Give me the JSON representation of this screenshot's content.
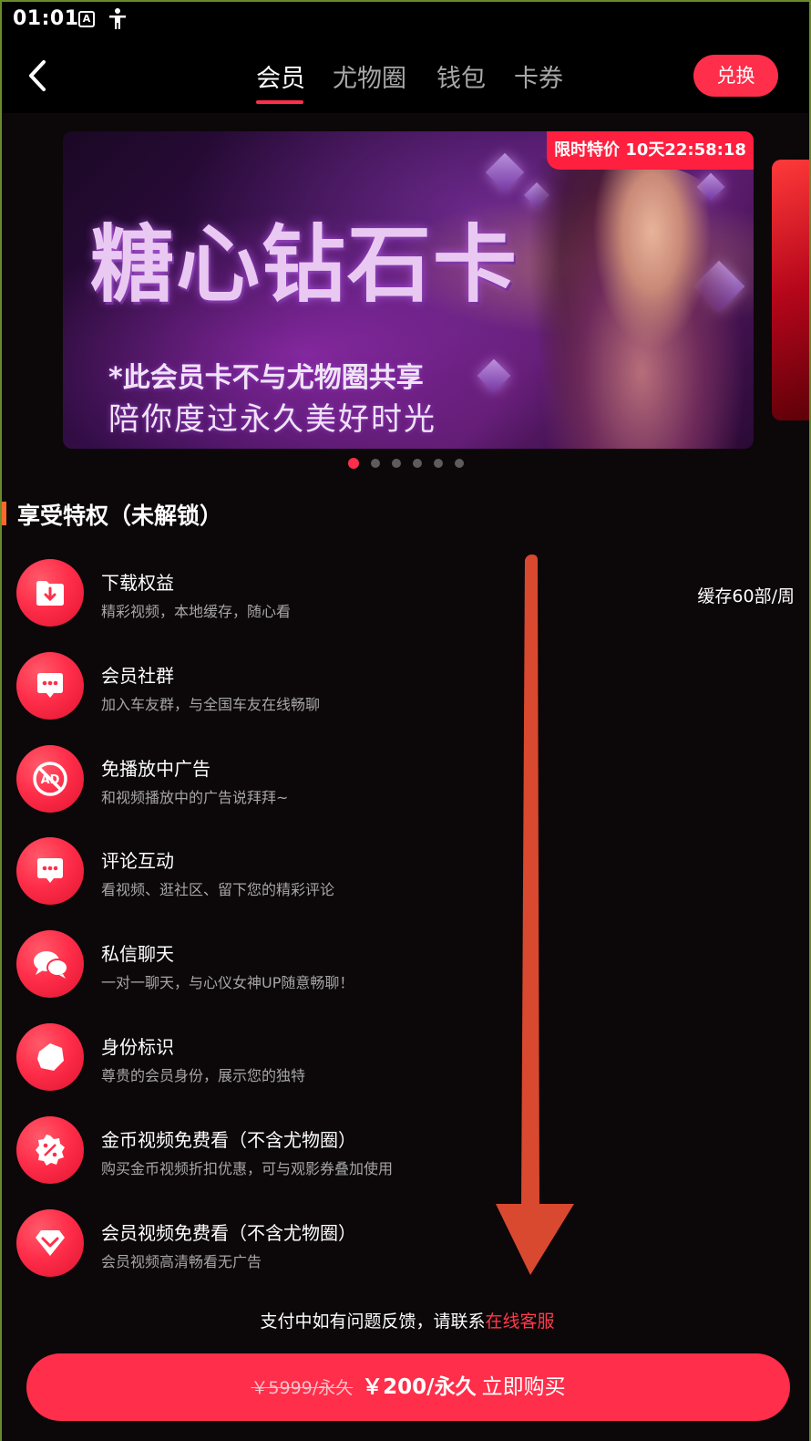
{
  "status_bar": {
    "time": "01:01",
    "icons": [
      "app-a-icon",
      "accessibility-icon"
    ]
  },
  "nav": {
    "tabs": [
      {
        "label": "会员",
        "active": true
      },
      {
        "label": "尤物圈",
        "active": false
      },
      {
        "label": "钱包",
        "active": false
      },
      {
        "label": "卡券",
        "active": false
      }
    ],
    "exchange_label": "兑换"
  },
  "banner": {
    "title": "糖心钻石卡",
    "line1": "*此会员卡不与尤物圈共享",
    "line2": "陪你度过永久美好时光",
    "promo_label": "限时特价 10天22:58:18",
    "dots_total": 6,
    "dots_active_index": 0
  },
  "section": {
    "title": "享受特权（未解锁）"
  },
  "privileges": [
    {
      "title": "下载权益",
      "desc": "精彩视频，本地缓存，随心看",
      "extra": "缓存60部/周",
      "icon": "download-folder-icon"
    },
    {
      "title": "会员社群",
      "desc": "加入车友群，与全国车友在线畅聊",
      "extra": "",
      "icon": "chat-bubble-icon"
    },
    {
      "title": "免播放中广告",
      "desc": "和视频播放中的广告说拜拜~",
      "extra": "",
      "icon": "no-ad-icon"
    },
    {
      "title": "评论互动",
      "desc": "看视频、逛社区、留下您的精彩评论",
      "extra": "",
      "icon": "comment-icon"
    },
    {
      "title": "私信聊天",
      "desc": "一对一聊天，与心仪女神UP随意畅聊！",
      "extra": "",
      "icon": "message-bubbles-icon"
    },
    {
      "title": "身份标识",
      "desc": "尊贵的会员身份，展示您的独特",
      "extra": "",
      "icon": "identity-badge-icon"
    },
    {
      "title": "金币视频免费看（不含尤物圈）",
      "desc": "购买金币视频折扣优惠，可与观影券叠加使用",
      "extra": "",
      "icon": "discount-icon"
    },
    {
      "title": "会员视频免费看（不含尤物圈）",
      "desc": "会员视频高清畅看无广告",
      "extra": "",
      "icon": "vip-diamond-icon"
    }
  ],
  "support": {
    "text": "支付中如有问题反馈，请联系",
    "link": "在线客服"
  },
  "purchase": {
    "old_price": "￥5999/永久",
    "new_price": "￥200/永久",
    "label": "立即购买"
  },
  "colors": {
    "accent": "#ff2e4a",
    "background": "#0c0709",
    "annotation_arrow": "#d9492f"
  }
}
